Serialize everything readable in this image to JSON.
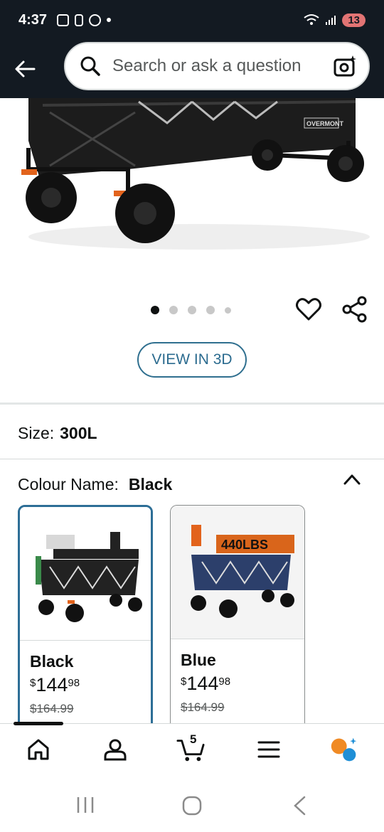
{
  "status_bar": {
    "time": "4:37",
    "battery": "13"
  },
  "header": {
    "search_placeholder": "Search or ask a question"
  },
  "gallery": {
    "dot_count": 5,
    "active_index": 0,
    "view_3d_label": "VIEW IN 3D"
  },
  "size": {
    "label": "Size:",
    "value": "300L"
  },
  "colour": {
    "label": "Colour Name:",
    "value": "Black",
    "options": [
      {
        "name": "Black",
        "currency": "$",
        "price_whole": "144",
        "price_cents": "98",
        "list_price": "$164.99",
        "selected": true,
        "accent": "#1f1f1f"
      },
      {
        "name": "Blue",
        "currency": "$",
        "price_whole": "144",
        "price_cents": "98",
        "list_price": "$164.99",
        "selected": false,
        "accent": "#2c3f6b"
      }
    ]
  },
  "bottom_nav": {
    "items": [
      "home-icon",
      "account-icon",
      "cart-icon",
      "menu-icon",
      "rufus-icon"
    ],
    "cart_count": "5"
  },
  "colors": {
    "header_bg": "#131a22",
    "selected_border": "#2d6e96",
    "link_blue": "#2b6b8f"
  }
}
